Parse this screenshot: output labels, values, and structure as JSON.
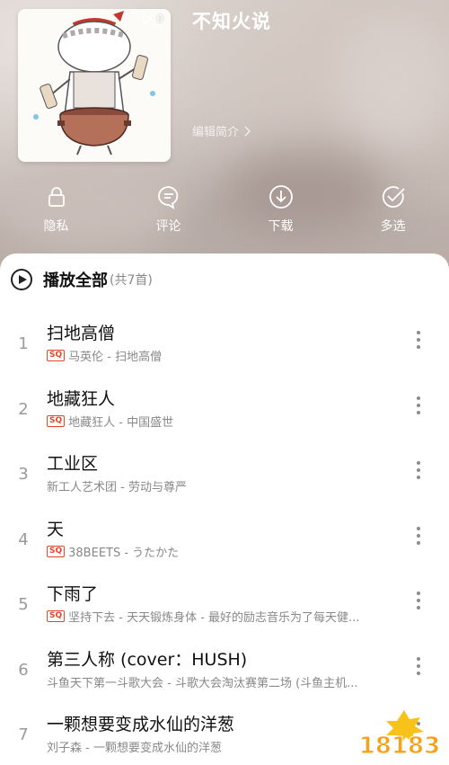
{
  "header": {
    "title": "不知火说",
    "play_count": "0",
    "edit_intro": "编辑简介",
    "actions": [
      {
        "label": "隐私",
        "icon": "lock-icon"
      },
      {
        "label": "评论",
        "icon": "comment-icon"
      },
      {
        "label": "下载",
        "icon": "download-icon"
      },
      {
        "label": "多选",
        "icon": "multi-select-icon"
      }
    ]
  },
  "list": {
    "play_all": "播放全部",
    "count": "(共7首)",
    "songs": [
      {
        "index": "1",
        "title": "扫地高僧",
        "sq": true,
        "subtitle": "马英伦 - 扫地高僧"
      },
      {
        "index": "2",
        "title": "地藏狂人",
        "sq": true,
        "subtitle": "地藏狂人 - 中国盛世"
      },
      {
        "index": "3",
        "title": "工业区",
        "sq": false,
        "subtitle": "新工人艺术团 - 劳动与尊严"
      },
      {
        "index": "4",
        "title": "天",
        "sq": true,
        "subtitle": "38BEETS - うたかた"
      },
      {
        "index": "5",
        "title": "下雨了",
        "sq": true,
        "subtitle": "坚持下去 - 天天锻炼身体 - 最好的励志音乐为了每天健..."
      },
      {
        "index": "6",
        "title": "第三人称 (cover：HUSH)",
        "sq": false,
        "subtitle": "斗鱼天下第一斗歌大会 - 斗歌大会淘汰赛第二场 (斗鱼主机..."
      },
      {
        "index": "7",
        "title": "一颗想要变成水仙的洋葱",
        "sq": false,
        "subtitle": "刘子森 - 一颗想要变成水仙的洋葱"
      }
    ],
    "sq_label": "SQ"
  },
  "watermark": {
    "text": "18183"
  },
  "colors": {
    "sq_badge": "#e0472b",
    "panel": "#ffffff",
    "header_tint": "#c4b8b3"
  }
}
